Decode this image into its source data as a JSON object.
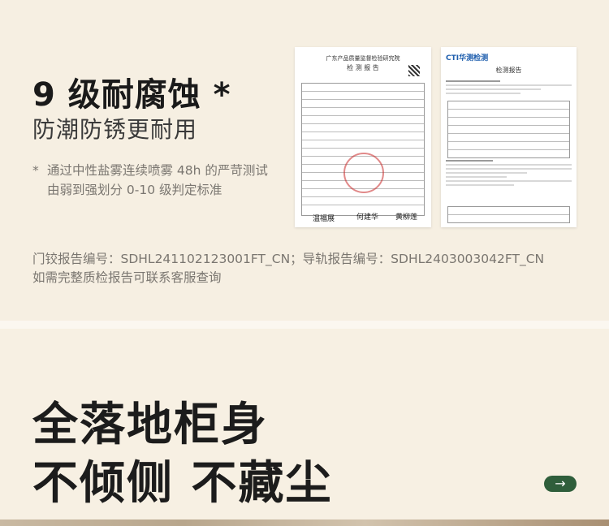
{
  "section1": {
    "title": "9 级耐腐蚀 *",
    "subtitle": "防潮防锈更耐用",
    "note_mark": "*",
    "note_text": "通过中性盐雾连续喷雾 48h 的严苛测试\n由弱到强划分 0-10 级判定标准",
    "report_line1": "门铰报告编号：SDHL241102123001FT_CN；导轨报告编号：SDHL2403003042FT_CN",
    "report_line2": "如需完整质检报告可联系客服查询"
  },
  "reports": [
    {
      "header": "广东产品质量监督检验研究院",
      "doc_title": "检 测 报 告",
      "signatures": [
        "温福展",
        "何建华",
        "黄柳莲"
      ]
    },
    {
      "logo": "CTI华测检测",
      "doc_title": "检测报告"
    }
  ],
  "section2": {
    "line1": "全落地柜身",
    "line2": "不倾侧 不藏尘",
    "arrow_icon": "→"
  },
  "colors": {
    "background": "#f6efe2",
    "accent_green": "#2f5e3b",
    "note_gray": "#7a7670"
  }
}
